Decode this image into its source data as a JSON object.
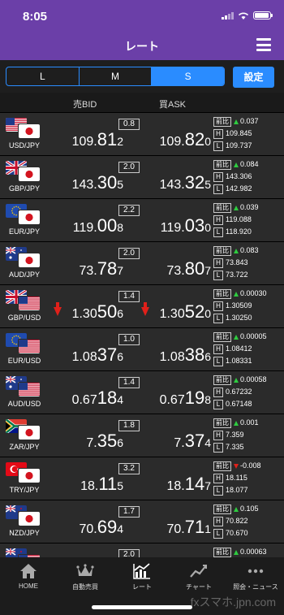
{
  "status_bar": {
    "time": "8:05"
  },
  "header": {
    "title": "レート"
  },
  "segments": [
    {
      "label": "L",
      "active": false
    },
    {
      "label": "M",
      "active": false
    },
    {
      "label": "S",
      "active": true
    }
  ],
  "settings_label": "設定",
  "columns": {
    "bid": "売BID",
    "ask": "買ASK"
  },
  "stat_labels": {
    "prev": "前比",
    "high": "H",
    "low": "L"
  },
  "rows": [
    {
      "pair": "USD/JPY",
      "flag1": "us",
      "flag2": "jp",
      "spread": "0.8",
      "bid": {
        "a": "109.",
        "b": "81",
        "c": "2"
      },
      "ask": {
        "a": "109.",
        "b": "82",
        "c": "0"
      },
      "arrow": "",
      "change": "0.037",
      "dir": "up",
      "high": "109.845",
      "low": "109.737"
    },
    {
      "pair": "GBP/JPY",
      "flag1": "gb",
      "flag2": "jp",
      "spread": "2.0",
      "bid": {
        "a": "143.",
        "b": "30",
        "c": "5"
      },
      "ask": {
        "a": "143.",
        "b": "32",
        "c": "5"
      },
      "arrow": "",
      "change": "0.084",
      "dir": "up",
      "high": "143.306",
      "low": "142.982"
    },
    {
      "pair": "EUR/JPY",
      "flag1": "eu",
      "flag2": "jp",
      "spread": "2.2",
      "bid": {
        "a": "119.",
        "b": "00",
        "c": "8"
      },
      "ask": {
        "a": "119.",
        "b": "03",
        "c": "0"
      },
      "arrow": "",
      "change": "0.039",
      "dir": "up",
      "high": "119.088",
      "low": "118.920"
    },
    {
      "pair": "AUD/JPY",
      "flag1": "au",
      "flag2": "jp",
      "spread": "2.0",
      "bid": {
        "a": "73.",
        "b": "78",
        "c": "7"
      },
      "ask": {
        "a": "73.",
        "b": "80",
        "c": "7"
      },
      "arrow": "",
      "change": "0.083",
      "dir": "up",
      "high": "73.843",
      "low": "73.722"
    },
    {
      "pair": "GBP/USD",
      "flag1": "gb",
      "flag2": "us",
      "spread": "1.4",
      "bid": {
        "a": "1.30",
        "b": "50",
        "c": "6"
      },
      "ask": {
        "a": "1.30",
        "b": "52",
        "c": "0"
      },
      "arrow": "down",
      "change": "0.00030",
      "dir": "up",
      "high": "1.30509",
      "low": "1.30250"
    },
    {
      "pair": "EUR/USD",
      "flag1": "eu",
      "flag2": "us",
      "spread": "1.0",
      "bid": {
        "a": "1.08",
        "b": "37",
        "c": "6"
      },
      "ask": {
        "a": "1.08",
        "b": "38",
        "c": "6"
      },
      "arrow": "",
      "change": "0.00005",
      "dir": "up",
      "high": "1.08412",
      "low": "1.08331"
    },
    {
      "pair": "AUD/USD",
      "flag1": "au",
      "flag2": "us",
      "spread": "1.4",
      "bid": {
        "a": "0.67",
        "b": "18",
        "c": "4"
      },
      "ask": {
        "a": "0.67",
        "b": "19",
        "c": "8"
      },
      "arrow": "",
      "change": "0.00058",
      "dir": "up",
      "high": "0.67232",
      "low": "0.67148"
    },
    {
      "pair": "ZAR/JPY",
      "flag1": "za",
      "flag2": "jp",
      "spread": "1.8",
      "bid": {
        "a": "7.",
        "b": "35",
        "c": "6"
      },
      "ask": {
        "a": "7.",
        "b": "37",
        "c": "4"
      },
      "arrow": "",
      "change": "0.001",
      "dir": "up",
      "high": "7.359",
      "low": "7.335"
    },
    {
      "pair": "TRY/JPY",
      "flag1": "tr",
      "flag2": "jp",
      "spread": "3.2",
      "bid": {
        "a": "18.",
        "b": "11",
        "c": "5"
      },
      "ask": {
        "a": "18.",
        "b": "14",
        "c": "7"
      },
      "arrow": "",
      "change": "-0.008",
      "dir": "down",
      "high": "18.115",
      "low": "18.077"
    },
    {
      "pair": "NZD/JPY",
      "flag1": "nz",
      "flag2": "jp",
      "spread": "1.7",
      "bid": {
        "a": "70.",
        "b": "69",
        "c": "4"
      },
      "ask": {
        "a": "70.",
        "b": "71",
        "c": "1"
      },
      "arrow": "",
      "change": "0.105",
      "dir": "up",
      "high": "70.822",
      "low": "70.670"
    },
    {
      "pair": "",
      "flag1": "nz",
      "flag2": "us",
      "spread": "2.0",
      "bid": {
        "a": "",
        "b": "",
        "c": ""
      },
      "ask": {
        "a": "",
        "b": "",
        "c": ""
      },
      "arrow": "",
      "change": "0.00063",
      "dir": "up",
      "high": "",
      "low": ""
    }
  ],
  "bottom_nav": [
    {
      "label": "HOME",
      "icon": "home-icon"
    },
    {
      "label": "自動売買",
      "icon": "crown-icon"
    },
    {
      "label": "レート",
      "icon": "rate-chart-icon"
    },
    {
      "label": "チャート",
      "icon": "line-chart-icon"
    },
    {
      "label": "照会・ニュース",
      "icon": "more-icon"
    }
  ],
  "watermark": "fxスマホ.jpn.com",
  "colors": {
    "header": "#6b3fa8",
    "accent": "#2a8cff",
    "up": "#2ecc40",
    "down": "#e0201a"
  }
}
